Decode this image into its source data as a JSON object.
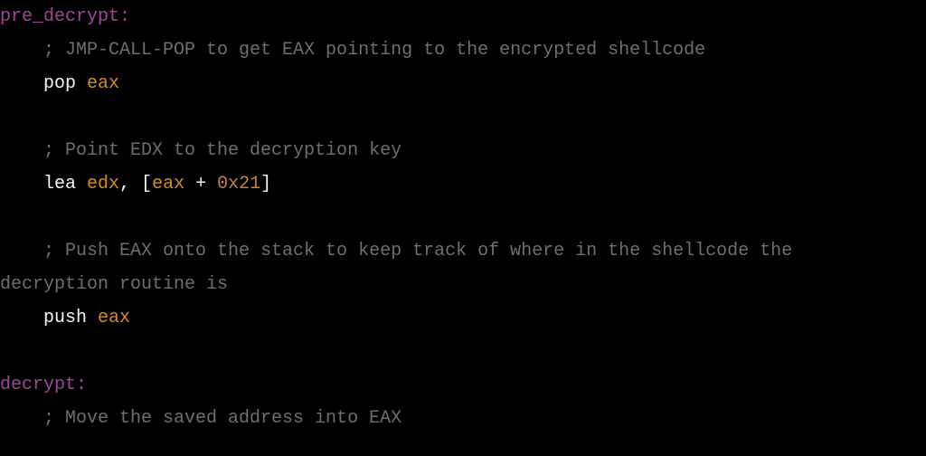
{
  "code": {
    "label_pre_decrypt": "pre_decrypt:",
    "c1": "    ; JMP-CALL-POP to get EAX pointing to the encrypted shellcode",
    "l2_indent": "    ",
    "l2_op": "pop ",
    "l2_reg": "eax",
    "c2": "    ; Point EDX to the decryption key",
    "l4_indent": "    ",
    "l4_op1": "lea ",
    "l4_reg1": "edx",
    "l4_punc1": ", [",
    "l4_reg2": "eax",
    "l4_punc2": " + ",
    "l4_num": "0x21",
    "l4_punc3": "]",
    "c3a": "    ; Push EAX onto the stack to keep track of where in the shellcode the",
    "c3b": "decryption routine is",
    "l6_indent": "    ",
    "l6_op": "push ",
    "l6_reg": "eax",
    "label_decrypt": "decrypt:",
    "c4": "    ; Move the saved address into EAX"
  }
}
